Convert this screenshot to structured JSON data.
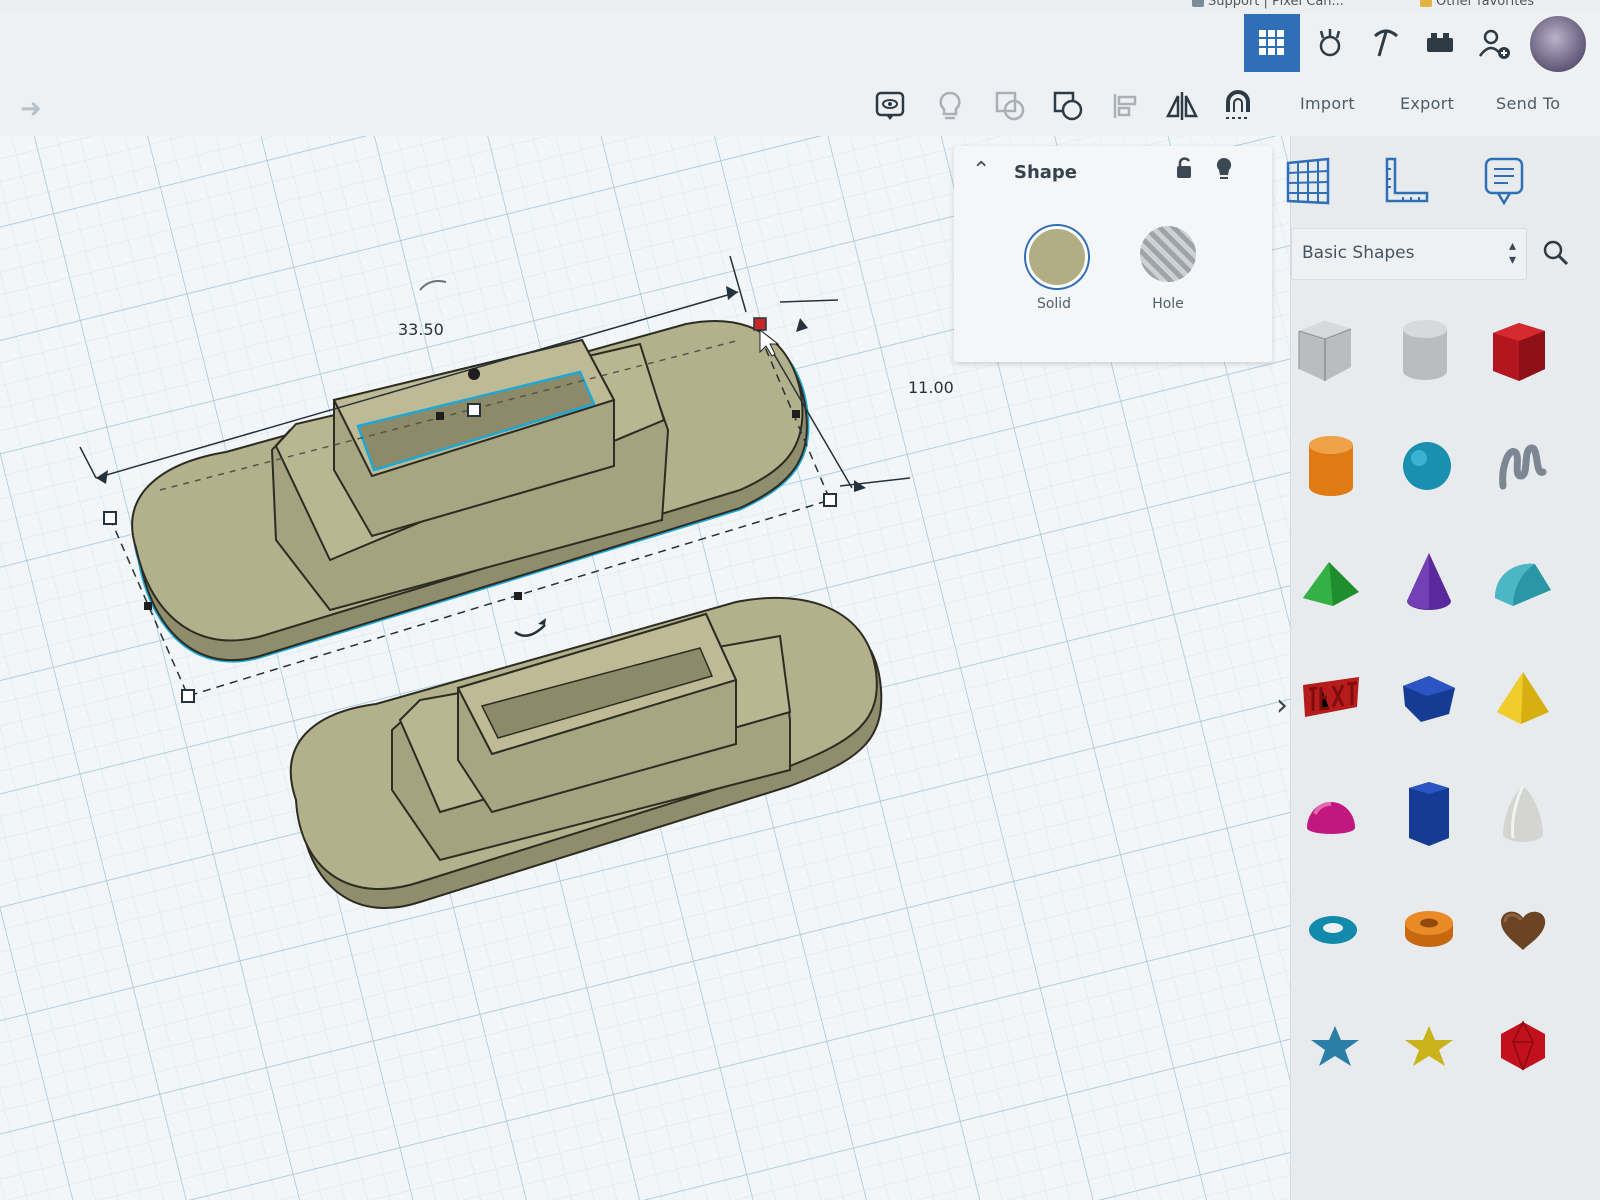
{
  "browser": {
    "bookmarks": [
      "Support | Pixel Can...",
      "Other favorites"
    ]
  },
  "topbar": {
    "icons": [
      "grid-view-icon",
      "tinkercad-blocks-icon",
      "pickaxe-icon",
      "bricks-icon",
      "add-user-icon"
    ],
    "active_icon": "grid-view-icon"
  },
  "toolbar": {
    "icons": [
      "note-icon",
      "show-all-icon",
      "group-icon",
      "ungroup-icon",
      "align-icon",
      "mirror-icon",
      "cruise-icon"
    ],
    "import_label": "Import",
    "export_label": "Export",
    "send_to_label": "Send To"
  },
  "workplane": {
    "length_dimension": "33.50",
    "width_dimension": "11.00"
  },
  "inspector": {
    "title": "Shape",
    "solid_label": "Solid",
    "hole_label": "Hole",
    "color": "#b1ae86"
  },
  "panel": {
    "library_label": "Basic Shapes",
    "shapes": [
      "box-hole",
      "cylinder-hole",
      "box",
      "cylinder",
      "sphere",
      "scribble",
      "roof",
      "cone",
      "round-roof",
      "text",
      "half-cylinder",
      "pyramid",
      "half-sphere",
      "polygon",
      "paraboloid",
      "torus",
      "tube",
      "heart",
      "star",
      "star-yellow",
      "icosahedron"
    ]
  },
  "colors": {
    "accent": "#2f6fb8",
    "selection": "#1fa8d6",
    "model": "#b1ae86",
    "grid": "#bcd6e2"
  }
}
